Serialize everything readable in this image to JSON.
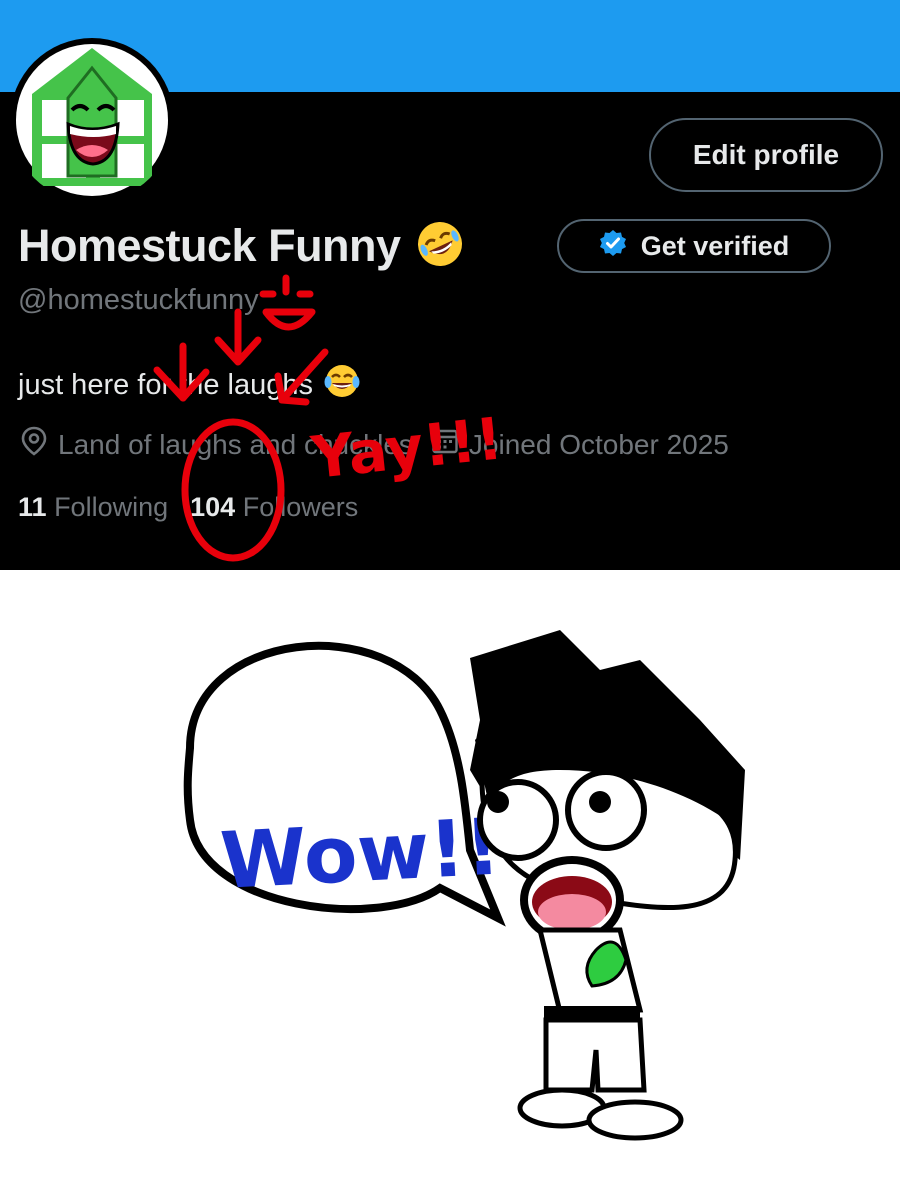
{
  "profile": {
    "display_name": "Homestuck Funny",
    "display_name_emoji": "rolling-on-floor-laughing-emoji",
    "handle": "@homestuckfunny",
    "bio": "just here for the laughs",
    "bio_emoji": "tears-of-joy-emoji",
    "location": "Land of laughs and chuckles",
    "joined": "Joined October 2025",
    "following_count": "11",
    "following_label": "Following",
    "followers_count": "104",
    "followers_label": "Followers"
  },
  "buttons": {
    "edit_profile": "Edit profile",
    "get_verified": "Get verified"
  },
  "doodle": {
    "yay_text": "Yay!!!",
    "wow_text": "Wow!!"
  },
  "colors": {
    "banner": "#1d9bf0",
    "background": "#000000",
    "secondary_text": "#71767b",
    "primary_text": "#e7e9ea",
    "verified_badge": "#1d9bf0",
    "doodle_red": "#e8000b",
    "doodle_blue": "#1a33cc",
    "avatar_green": "#45c34a"
  },
  "icons": {
    "location": "location-pin-icon",
    "calendar": "calendar-icon",
    "verified": "verified-badge-icon"
  }
}
